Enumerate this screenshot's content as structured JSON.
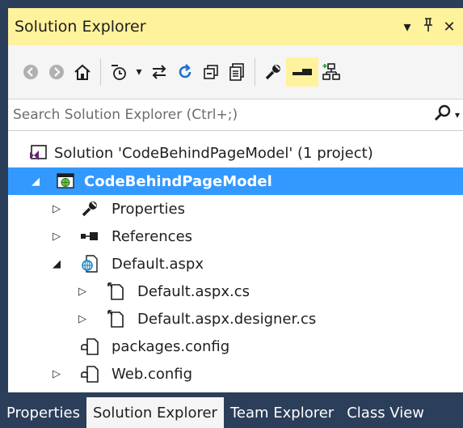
{
  "window": {
    "title": "Solution Explorer",
    "buttons": {
      "dropdown": "▾",
      "pin": "⊥",
      "close": "✕"
    }
  },
  "toolbar": {
    "items": [
      {
        "icon": "back-icon",
        "glyph": "◀",
        "enabled": false
      },
      {
        "icon": "forward-icon",
        "glyph": "▶",
        "enabled": false
      },
      {
        "icon": "home-icon",
        "glyph": "⌂",
        "enabled": true
      },
      {
        "icon": "pending-changes-filter-icon",
        "glyph": "◷",
        "enabled": true
      },
      {
        "icon": "filter-dropdown-icon",
        "glyph": "▾",
        "enabled": true
      },
      {
        "icon": "sync-with-active-document-icon",
        "glyph": "⇆",
        "enabled": true
      },
      {
        "icon": "refresh-icon",
        "glyph": "↻",
        "enabled": true
      },
      {
        "icon": "collapse-all-icon",
        "glyph": "❐",
        "enabled": true
      },
      {
        "icon": "show-all-files-icon",
        "glyph": "▤",
        "enabled": true
      },
      {
        "icon": "properties-icon",
        "glyph": "✎",
        "enabled": true
      },
      {
        "icon": "preview-selected-items-icon",
        "glyph": "▬",
        "enabled": true
      },
      {
        "icon": "view-class-diagram-icon",
        "glyph": "⛶",
        "enabled": true
      }
    ]
  },
  "search": {
    "placeholder": "Search Solution Explorer (Ctrl+;)",
    "value": "",
    "icon": "search-icon"
  },
  "tree": {
    "items": [
      {
        "label": "Solution 'CodeBehindPageModel' (1 project)",
        "icon": "solution-icon",
        "expander": "",
        "level": 0,
        "selected": false
      },
      {
        "label": "CodeBehindPageModel",
        "icon": "web-project-icon",
        "expander": "◢",
        "level": 0,
        "selected": true
      },
      {
        "label": "Properties",
        "icon": "wrench-icon",
        "expander": "▷",
        "level": 1,
        "selected": false
      },
      {
        "label": "References",
        "icon": "references-icon",
        "expander": "▷",
        "level": 1,
        "selected": false
      },
      {
        "label": "Default.aspx",
        "icon": "aspx-page-icon",
        "expander": "◢",
        "level": 1,
        "selected": false
      },
      {
        "label": "Default.aspx.cs",
        "icon": "code-file-icon",
        "expander": "▷",
        "level": 2,
        "selected": false
      },
      {
        "label": "Default.aspx.designer.cs",
        "icon": "code-file-icon",
        "expander": "▷",
        "level": 2,
        "selected": false
      },
      {
        "label": "packages.config",
        "icon": "config-file-icon",
        "expander": "",
        "level": 1,
        "selected": false
      },
      {
        "label": "Web.config",
        "icon": "config-file-icon",
        "expander": "▷",
        "level": 1,
        "selected": false
      }
    ]
  },
  "bottom_tabs": [
    {
      "label": "Properties",
      "active": false
    },
    {
      "label": "Solution Explorer",
      "active": true
    },
    {
      "label": "Team Explorer",
      "active": false
    },
    {
      "label": "Class View",
      "active": false
    }
  ],
  "colors": {
    "title_bar": "#fff29d",
    "selection": "#3399ff",
    "background": "#2b3e5a",
    "web_globe": "#1e88c7",
    "vs_purple": "#68217a"
  }
}
